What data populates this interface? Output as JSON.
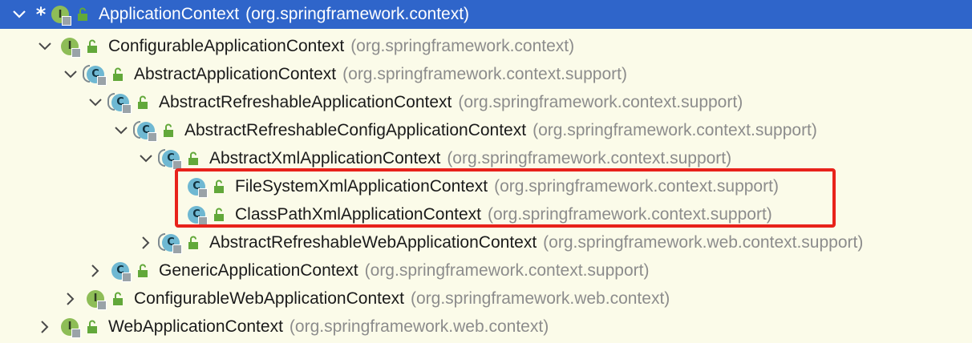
{
  "tree": {
    "root": {
      "name": "ApplicationContext",
      "package": "(org.springframework.context)",
      "kind": "I",
      "marker": "*"
    },
    "nodes": [
      {
        "name": "ConfigurableApplicationContext",
        "package": "(org.springframework.context)",
        "kind": "I",
        "expand": "expanded"
      },
      {
        "name": "AbstractApplicationContext",
        "package": "(org.springframework.context.support)",
        "kind": "C",
        "expand": "expanded"
      },
      {
        "name": "AbstractRefreshableApplicationContext",
        "package": "(org.springframework.context.support)",
        "kind": "C",
        "expand": "expanded"
      },
      {
        "name": "AbstractRefreshableConfigApplicationContext",
        "package": "(org.springframework.context.support)",
        "kind": "C",
        "expand": "expanded"
      },
      {
        "name": "AbstractXmlApplicationContext",
        "package": "(org.springframework.context.support)",
        "kind": "C",
        "expand": "expanded"
      },
      {
        "name": "FileSystemXmlApplicationContext",
        "package": "(org.springframework.context.support)",
        "kind": "C",
        "expand": "leaf"
      },
      {
        "name": "ClassPathXmlApplicationContext",
        "package": "(org.springframework.context.support)",
        "kind": "C",
        "expand": "leaf"
      },
      {
        "name": "AbstractRefreshableWebApplicationContext",
        "package": "(org.springframework.web.context.support)",
        "kind": "C",
        "expand": "collapsed"
      },
      {
        "name": "GenericApplicationContext",
        "package": "(org.springframework.context.support)",
        "kind": "C",
        "expand": "collapsed"
      },
      {
        "name": "ConfigurableWebApplicationContext",
        "package": "(org.springframework.web.context)",
        "kind": "I",
        "expand": "collapsed"
      },
      {
        "name": "WebApplicationContext",
        "package": "(org.springframework.web.context)",
        "kind": "I",
        "expand": "collapsed"
      }
    ]
  },
  "colors": {
    "background": "#fbfbe9",
    "selection": "#2f65ca",
    "interface_icon": "#8ebd57",
    "class_icon": "#6fb8d2",
    "highlight_border": "#e8221b",
    "package_text": "#8c8c8c",
    "lock_icon": "#62a83a"
  },
  "icons": {
    "expanded": "chevron-down-icon",
    "collapsed": "chevron-right-icon",
    "interface": "interface-icon",
    "class": "class-icon",
    "visibility": "lock-open-icon"
  }
}
